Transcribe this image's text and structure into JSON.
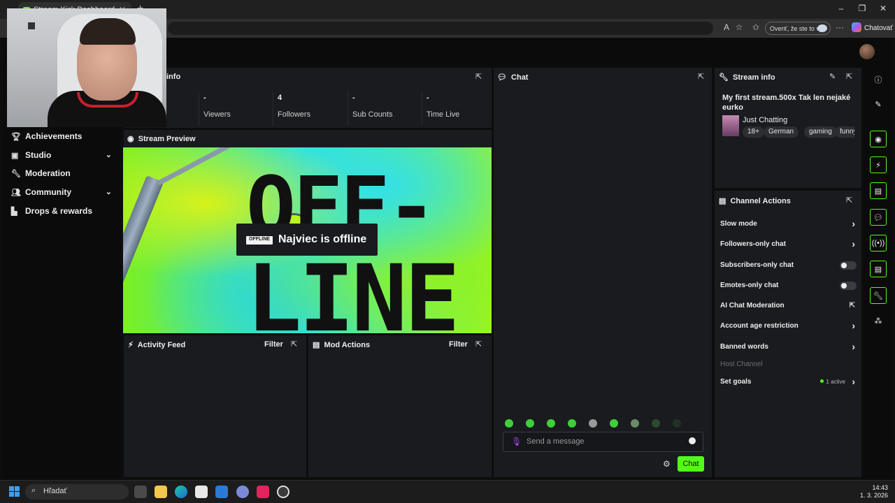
{
  "browser": {
    "tab_title": "Stream Kick Dashboard",
    "verify_label": "Overiť, že ste to vy",
    "copilot_label": "Chatovať"
  },
  "sidebar": {
    "items": [
      {
        "label": "Achievements",
        "icon": "trophy-icon",
        "expandable": false
      },
      {
        "label": "Studio",
        "icon": "studio-icon",
        "expandable": true
      },
      {
        "label": "Moderation",
        "icon": "wrench-icon",
        "expandable": false
      },
      {
        "label": "Community",
        "icon": "community-icon",
        "expandable": true
      },
      {
        "label": "Drops & rewards",
        "icon": "drops-icon",
        "expandable": false
      }
    ]
  },
  "stats": {
    "title_fragment": "info",
    "items": [
      {
        "value": "-",
        "label": "Viewers"
      },
      {
        "value": "4",
        "label": "Followers"
      },
      {
        "value": "-",
        "label": "Sub Counts"
      },
      {
        "value": "-",
        "label": "Time Live"
      }
    ]
  },
  "preview": {
    "title": "Stream Preview",
    "badge": "OFFLINE",
    "message": "Najviec is offline",
    "art_line1": "OFF-",
    "art_line2": "LINE"
  },
  "activity": {
    "title": "Activity Feed",
    "filter": "Filter"
  },
  "mod_actions": {
    "title": "Mod Actions",
    "filter": "Filter"
  },
  "chat": {
    "title": "Chat",
    "placeholder": "Send a message",
    "send_label": "Chat"
  },
  "stream_info": {
    "title": "Stream info",
    "stream_title": "My first stream.500x Tak len nejaké eurko",
    "category": "Just Chatting",
    "tags": [
      "18+",
      "German",
      "gaming",
      "funny"
    ]
  },
  "channel_actions": {
    "title": "Channel Actions",
    "items": [
      {
        "label": "Slow mode",
        "control": "chevron"
      },
      {
        "label": "Followers-only chat",
        "control": "chevron"
      },
      {
        "label": "Subscribers-only chat",
        "control": "toggle",
        "on": false
      },
      {
        "label": "Emotes-only chat",
        "control": "toggle",
        "on": false
      },
      {
        "label": "AI Chat Moderation",
        "control": "external"
      },
      {
        "label": "Account age restriction",
        "control": "chevron"
      },
      {
        "label": "Banned words",
        "control": "chevron"
      },
      {
        "label": "Host Channel",
        "control": "disabled"
      },
      {
        "label": "Set goals",
        "control": "chevron",
        "status": "1 active"
      }
    ]
  },
  "taskbar": {
    "search_label": "Hľadať",
    "time": "14:43",
    "date": "1. 3. 2026"
  },
  "colors": {
    "accent": "#53fc18",
    "panel": "#191b1f",
    "bg": "#0d0d0d"
  }
}
